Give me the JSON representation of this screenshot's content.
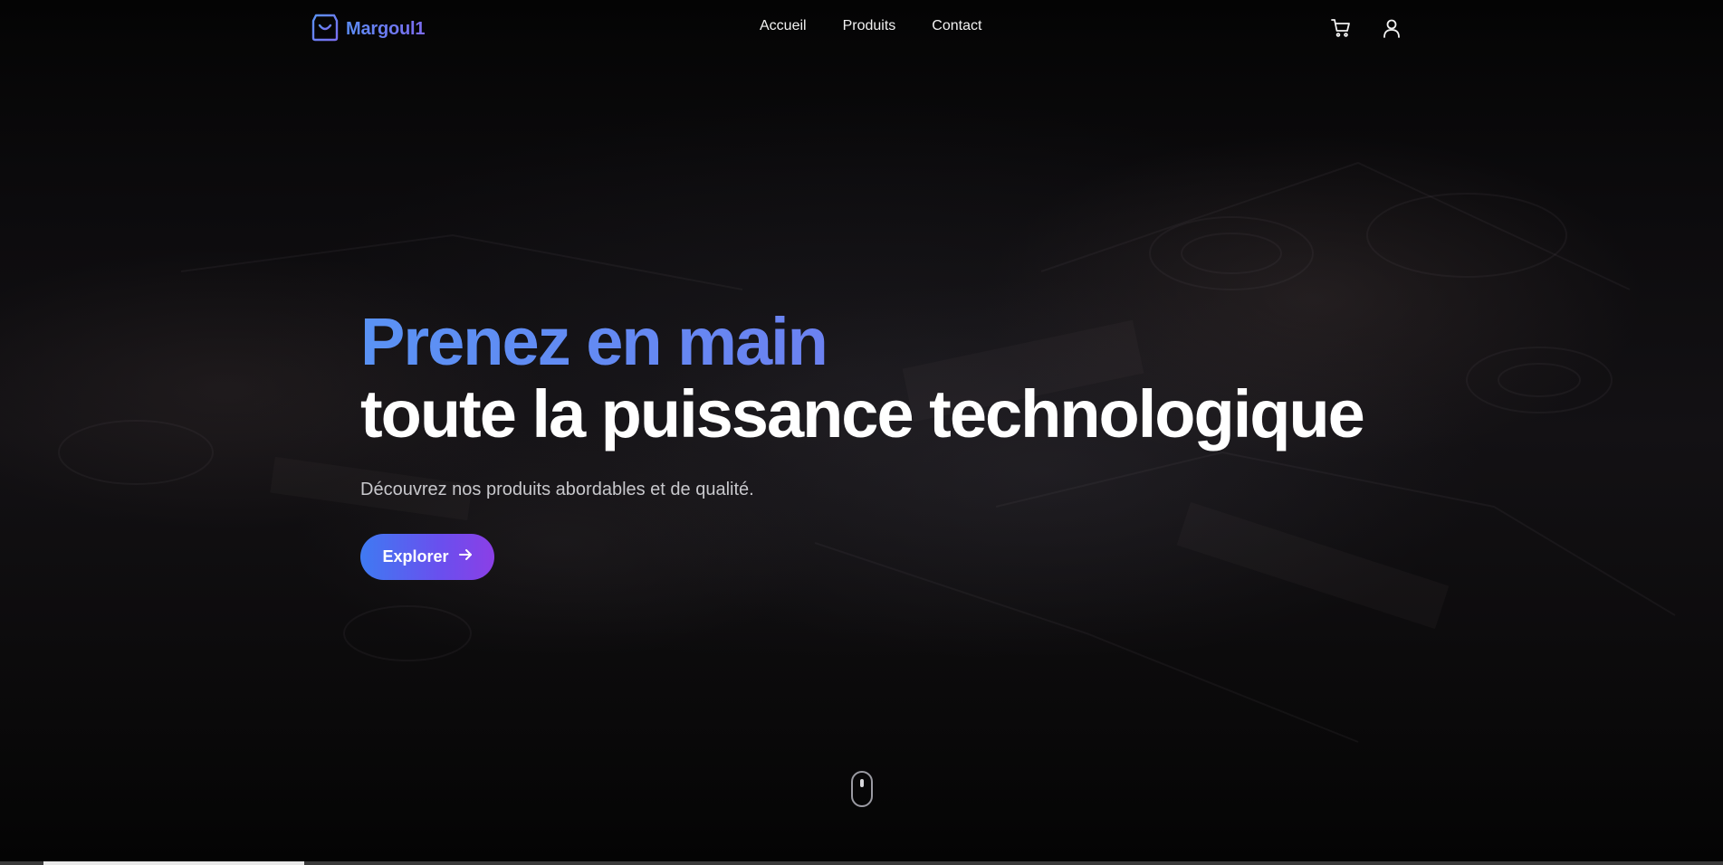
{
  "brand": {
    "name": "Margoul1",
    "icon": "shopping-bag-icon",
    "gradient": [
      "#5b8cf5",
      "#7c6cf0"
    ]
  },
  "nav": {
    "links": [
      "Accueil",
      "Produits",
      "Contact"
    ],
    "icons": [
      "cart-icon",
      "user-icon"
    ]
  },
  "hero": {
    "title_line1": "Prenez en main",
    "title_line2": "toute la puissance technologique",
    "subtitle": "Découvrez nos produits abordables et de qualité.",
    "cta_label": "Explorer",
    "cta_icon": "arrow-right-icon",
    "cta_gradient": [
      "#3f7af2",
      "#8b3fe6"
    ]
  },
  "scroll_indicator": {
    "icon": "mouse-scroll-icon"
  }
}
